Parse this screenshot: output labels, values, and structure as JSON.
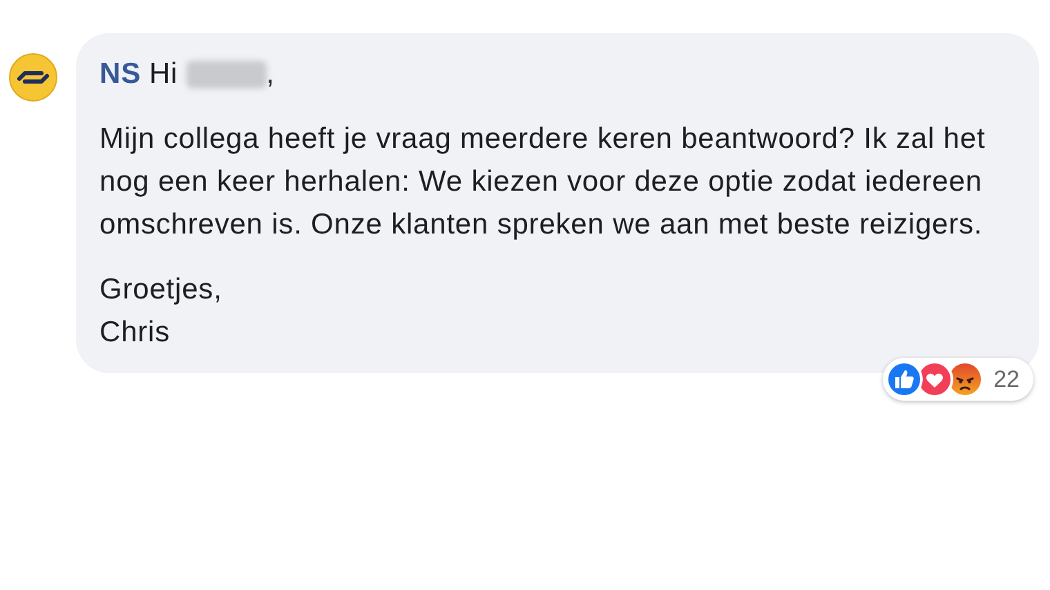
{
  "comment": {
    "author": "NS",
    "greeting": "Hi",
    "name_redacted": true,
    "trailing": ",",
    "paragraphs": [
      "Mijn collega heeft je vraag meerdere keren beantwoord? Ik zal het nog een keer herhalen: We kiezen voor deze optie zodat iedereen omschreven is. Onze klanten spreken we aan met beste reizigers.",
      "Groetjes,\nChris"
    ],
    "reactions": [
      {
        "kind": "like"
      },
      {
        "kind": "love"
      },
      {
        "kind": "angry"
      }
    ],
    "reaction_count": "22"
  }
}
